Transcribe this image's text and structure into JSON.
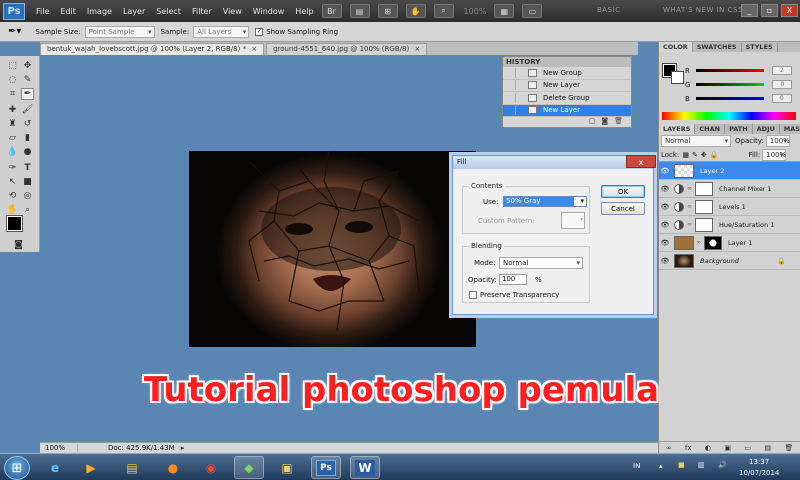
{
  "menubar": {
    "logo": "Ps",
    "items": [
      "File",
      "Edit",
      "Image",
      "Layer",
      "Select",
      "Filter",
      "View",
      "Window",
      "Help"
    ],
    "zoom": "100%",
    "workspaces": [
      "BASIC",
      "WHAT'S NEW IN CS5"
    ],
    "window_buttons": [
      "_",
      "▫",
      "X"
    ]
  },
  "options_bar": {
    "sample_size_label": "Sample Size:",
    "sample_size_value": "Point Sample",
    "sample_label": "Sample:",
    "sample_value": "All Layers",
    "show_ring_label": "Show Sampling Ring"
  },
  "doc_tabs": [
    "bentuk_wajah_lovebscott.jpg @ 100% (Layer 2, RGB/8) *",
    "ground-4551_640.jpg @ 100% (RGB/8)"
  ],
  "status": {
    "zoom": "100%",
    "doc": "Doc: 425.9K/1.43M"
  },
  "history": {
    "title": "HISTORY",
    "items": [
      "New Group",
      "New Layer",
      "Delete Group",
      "New Layer"
    ],
    "selected_index": 3
  },
  "color_panel": {
    "tabs": [
      "COLOR",
      "SWATCHES",
      "STYLES"
    ],
    "channels": [
      {
        "label": "R",
        "value": "2",
        "color": "#e01010"
      },
      {
        "label": "G",
        "value": "0",
        "color": "#10b010"
      },
      {
        "label": "B",
        "value": "0",
        "color": "#1010e0"
      }
    ]
  },
  "layers_panel": {
    "tabs": [
      "LAYERS",
      "CHAN",
      "PATH",
      "ADJU",
      "MASK"
    ],
    "blend_mode": "Normal",
    "opacity_label": "Opacity:",
    "opacity_value": "100%",
    "lock_label": "Lock:",
    "fill_label": "Fill:",
    "fill_value": "100%",
    "layers": [
      {
        "name": "Layer 2",
        "kind": "transparent",
        "selected": true
      },
      {
        "name": "Channel Mixer 1",
        "kind": "adjustment"
      },
      {
        "name": "Levels 1",
        "kind": "adjustment"
      },
      {
        "name": "Hue/Saturation 1",
        "kind": "adjustment"
      },
      {
        "name": "Layer 1",
        "kind": "texture"
      },
      {
        "name": "Background",
        "kind": "photo",
        "locked": true
      }
    ],
    "footer_icons": [
      "fx",
      "◐",
      "▣",
      "▭",
      "▤",
      "🗑"
    ]
  },
  "fill_dialog": {
    "title": "Fill",
    "close": "x",
    "contents_label": "Contents",
    "use_label": "Use:",
    "use_value": "50% Gray",
    "custom_pattern_label": "Custom Pattern:",
    "blending_label": "Blending",
    "mode_label": "Mode:",
    "mode_value": "Normal",
    "opacity_label": "Opacity:",
    "opacity_value": "100",
    "opacity_unit": "%",
    "preserve_label": "Preserve Transparency",
    "ok": "OK",
    "cancel": "Cancel"
  },
  "overlay_title": "Tutorial photoshop pemula",
  "taskbar": {
    "apps": [
      "ie-icon",
      "media-player-icon",
      "explorer-icon",
      "firefox-icon",
      "chrome-icon",
      "network-icon",
      "video-icon",
      "photoshop-icon",
      "word-icon"
    ],
    "language": "IN",
    "time": "13:37",
    "date": "10/07/2014"
  }
}
